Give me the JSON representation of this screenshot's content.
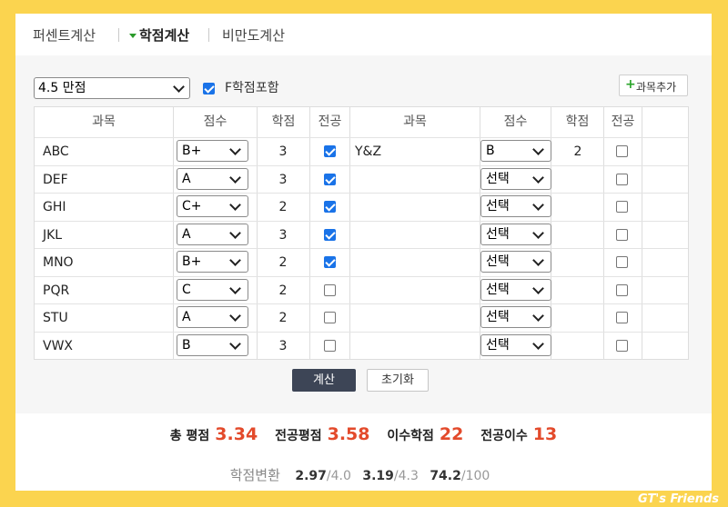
{
  "tabs": [
    {
      "label": "퍼센트계산"
    },
    {
      "label": "학점계산"
    },
    {
      "label": "비만도계산"
    }
  ],
  "controls": {
    "scale_value": "4.5 만점",
    "include_f_label": "F학점포함",
    "include_f_checked": true,
    "add_course_label": "과목추가"
  },
  "table": {
    "headers": [
      "과목",
      "점수",
      "학점",
      "전공",
      "과목",
      "점수",
      "학점",
      "전공"
    ],
    "left_rows": [
      {
        "course": "ABC",
        "grade": "B+",
        "credits": "3",
        "major": true
      },
      {
        "course": "DEF",
        "grade": "A",
        "credits": "3",
        "major": true
      },
      {
        "course": "GHI",
        "grade": "C+",
        "credits": "2",
        "major": true
      },
      {
        "course": "JKL",
        "grade": "A",
        "credits": "3",
        "major": true
      },
      {
        "course": "MNO",
        "grade": "B+",
        "credits": "2",
        "major": true
      },
      {
        "course": "PQR",
        "grade": "C",
        "credits": "2",
        "major": false
      },
      {
        "course": "STU",
        "grade": "A",
        "credits": "2",
        "major": false
      },
      {
        "course": "VWX",
        "grade": "B",
        "credits": "3",
        "major": false
      }
    ],
    "right_rows": [
      {
        "course": "Y&Z",
        "grade": "B",
        "credits": "2",
        "major": false
      },
      {
        "course": "",
        "grade": "선택",
        "credits": "",
        "major": false
      },
      {
        "course": "",
        "grade": "선택",
        "credits": "",
        "major": false
      },
      {
        "course": "",
        "grade": "선택",
        "credits": "",
        "major": false
      },
      {
        "course": "",
        "grade": "선택",
        "credits": "",
        "major": false
      },
      {
        "course": "",
        "grade": "선택",
        "credits": "",
        "major": false
      },
      {
        "course": "",
        "grade": "선택",
        "credits": "",
        "major": false
      },
      {
        "course": "",
        "grade": "선택",
        "credits": "",
        "major": false
      }
    ]
  },
  "actions": {
    "calculate_label": "계산",
    "reset_label": "초기화"
  },
  "results": {
    "total_gpa_label": "총 평점",
    "total_gpa": "3.34",
    "major_gpa_label": "전공평점",
    "major_gpa": "3.58",
    "credits_label": "이수학점",
    "credits": "22",
    "major_credits_label": "전공이수",
    "major_credits": "13"
  },
  "conversion": {
    "label": "학점변환",
    "items": [
      {
        "value": "2.97",
        "max": "/4.0"
      },
      {
        "value": "3.19",
        "max": "/4.3"
      },
      {
        "value": "74.2",
        "max": "/100"
      }
    ]
  },
  "footer_credit": "GT's Friends",
  "colors": {
    "background": "#fbd44f",
    "accent_red": "#e34a2b",
    "calc_button": "#3d4556",
    "checkbox_blue": "#1a73e8",
    "active_tab_marker": "#2a9a2a"
  }
}
